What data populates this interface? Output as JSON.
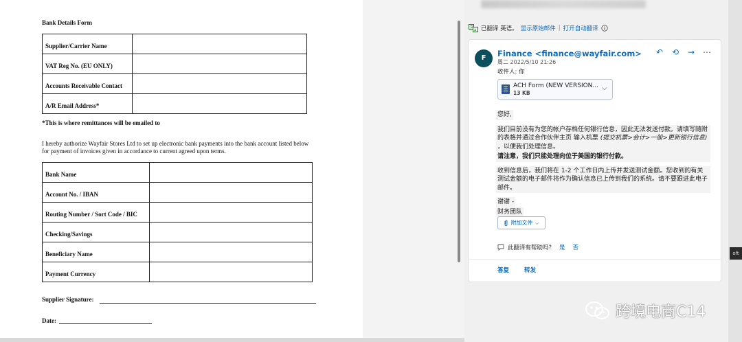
{
  "document": {
    "title": "Bank Details Form",
    "carrier_table": [
      {
        "label": "Supplier/Carrier Name"
      },
      {
        "label": "VAT Reg No. (EU ONLY)"
      },
      {
        "label": "Accounts Receivable Contact"
      },
      {
        "label": "A/R Email Address*"
      }
    ],
    "remit_note": "*This is where remittances will be emailed to",
    "authorization_text": "I hereby authorize Wayfair Stores Ltd to set up electronic bank payments into the bank account listed below for payment of invoices given in accordance to current agreed upon terms.",
    "bank_table": [
      {
        "label": "Bank Name"
      },
      {
        "label": "Account No. / IBAN"
      },
      {
        "label": "Routing Number / Sort Code / BIC"
      },
      {
        "label": "Checking/Savings"
      },
      {
        "label": "Beneficiary Name"
      },
      {
        "label": "Payment Currency"
      }
    ],
    "signature_label": "Supplier Signature:",
    "date_label": "Date:"
  },
  "mail": {
    "translate_bar": {
      "status": "已翻译 英语。",
      "show_original": "显示原始邮件",
      "separator": "|",
      "auto_translate": "打开自动翻译"
    },
    "avatar_letter": "F",
    "sender": "Finance <finance@wayfair.com>",
    "date": "周二 2022/5/10 21:26",
    "to": "收件人: 你",
    "attachment": {
      "name": "ACH Form (NEW VERSION...",
      "size": "13 KB"
    },
    "body": {
      "greeting": "您好,",
      "p1_a": "我们目前没有为您的帐户存档任何银行信息，因此无法发送付款。请填写随附的表格并通过合作伙伴主页 输入机票 ",
      "p1_italic": "(提交机票>会计>一般>更新银行信息)",
      "p1_b": " ，以便我们处理信息。",
      "p1_bold": "请注意，我们只能处理向位于美国的银行付款。",
      "p2": "收到信息后，我们将在 1-2 个工作日内上传并发送测试金额。您收到的有关测试金额的电子邮件将作为确认信息已上传到我们的系统。请不要跟进此电子邮件。",
      "thanks": "谢谢 -",
      "team": "财务团队"
    },
    "attach_file_button": "附加文件",
    "feedback": {
      "question": "此翻译有帮助吗?",
      "yes": "是",
      "no": "否"
    },
    "reply": "答复",
    "forward": "转发"
  },
  "right_edge_text": "oft",
  "watermark": "跨境电商C14"
}
